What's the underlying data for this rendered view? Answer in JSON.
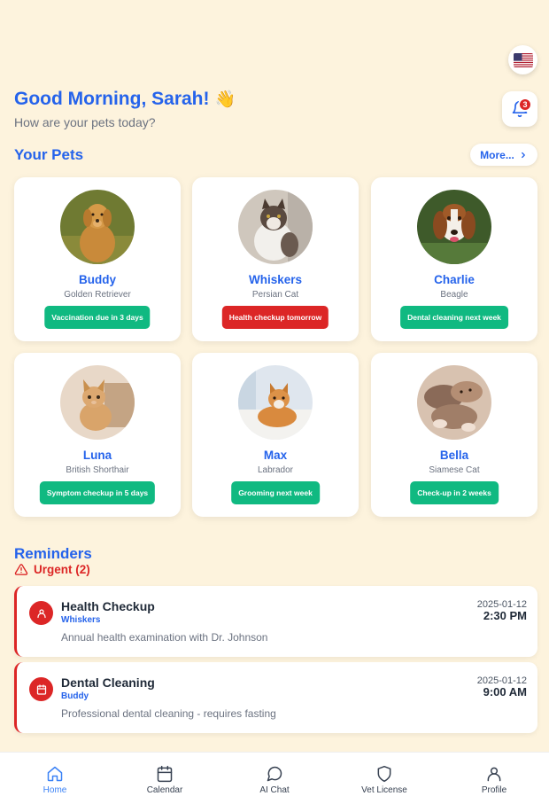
{
  "header": {
    "greeting": "Good Morning, Sarah!",
    "wave_emoji": "👋",
    "subtitle": "How are your pets today?",
    "notification_count": "3",
    "language_icon": "us-flag-icon"
  },
  "pets_section": {
    "title": "Your Pets",
    "more_label": "More..."
  },
  "pets": [
    {
      "name": "Buddy",
      "breed": "Golden Retriever",
      "status": "Vaccination due in 3 days",
      "status_color": "#10b981"
    },
    {
      "name": "Whiskers",
      "breed": "Persian Cat",
      "status": "Health checkup tomorrow",
      "status_color": "#dc2626"
    },
    {
      "name": "Charlie",
      "breed": "Beagle",
      "status": "Dental cleaning next week",
      "status_color": "#10b981"
    },
    {
      "name": "Luna",
      "breed": "British Shorthair",
      "status": "Symptom checkup in 5 days",
      "status_color": "#10b981"
    },
    {
      "name": "Max",
      "breed": "Labrador",
      "status": "Grooming next week",
      "status_color": "#10b981"
    },
    {
      "name": "Bella",
      "breed": "Siamese Cat",
      "status": "Check-up in 2 weeks",
      "status_color": "#10b981"
    }
  ],
  "reminders": {
    "title": "Reminders",
    "urgent_label": "Urgent (2)",
    "items": [
      {
        "title": "Health Checkup",
        "pet": "Whiskers",
        "description": "Annual health examination with Dr. Johnson",
        "date": "2025-01-12",
        "time": "2:30 PM",
        "icon": "user-icon"
      },
      {
        "title": "Dental Cleaning",
        "pet": "Buddy",
        "description": "Professional dental cleaning - requires fasting",
        "date": "2025-01-12",
        "time": "9:00 AM",
        "icon": "calendar-icon"
      }
    ]
  },
  "nav": {
    "items": [
      {
        "label": "Home",
        "icon": "home-icon",
        "active": true
      },
      {
        "label": "Calendar",
        "icon": "calendar-icon",
        "active": false
      },
      {
        "label": "AI Chat",
        "icon": "chat-bubble-icon",
        "active": false
      },
      {
        "label": "Vet License",
        "icon": "shield-icon",
        "active": false
      },
      {
        "label": "Profile",
        "icon": "user-icon",
        "active": false
      }
    ]
  },
  "colors": {
    "background": "#fdf3dd",
    "primary": "#2563eb",
    "success": "#10b981",
    "danger": "#dc2626"
  }
}
